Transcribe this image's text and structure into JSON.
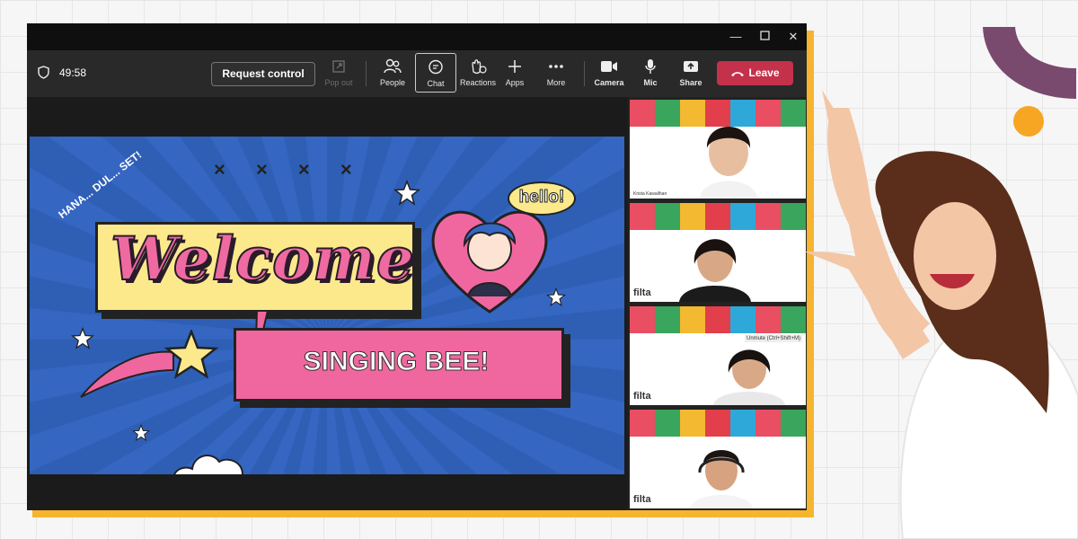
{
  "meeting": {
    "timer": "49:58",
    "request_control": "Request control",
    "toolbar": [
      {
        "label": "Pop out",
        "icon": "pop-out-icon"
      },
      {
        "label": "People",
        "icon": "people-icon"
      },
      {
        "label": "Chat",
        "icon": "chat-icon"
      },
      {
        "label": "Reactions",
        "icon": "reactions-icon"
      },
      {
        "label": "Apps",
        "icon": "apps-icon"
      },
      {
        "label": "More",
        "icon": "more-icon"
      },
      {
        "label": "Camera",
        "icon": "camera-icon"
      },
      {
        "label": "Mic",
        "icon": "mic-icon"
      },
      {
        "label": "Share",
        "icon": "share-icon"
      }
    ],
    "leave": "Leave"
  },
  "slide": {
    "hana_text": "HANA... DUL... SET!",
    "welcome": "Welcome",
    "title": "SINGING BEE!",
    "hello": "hello!",
    "crosses": "× × × ×"
  },
  "participants": {
    "brand": "filta",
    "tile1_name": "Krista Kawailhan",
    "unmute_hint": "Unmute (Ctrl+Shift+M)"
  },
  "colors": {
    "accent_yellow": "#f6b52e",
    "leave_red": "#c4314b",
    "slide_blue": "#3466c2",
    "pink": "#f0679f",
    "deco_purple": "#7a4a6e",
    "deco_orange": "#f6a623"
  }
}
